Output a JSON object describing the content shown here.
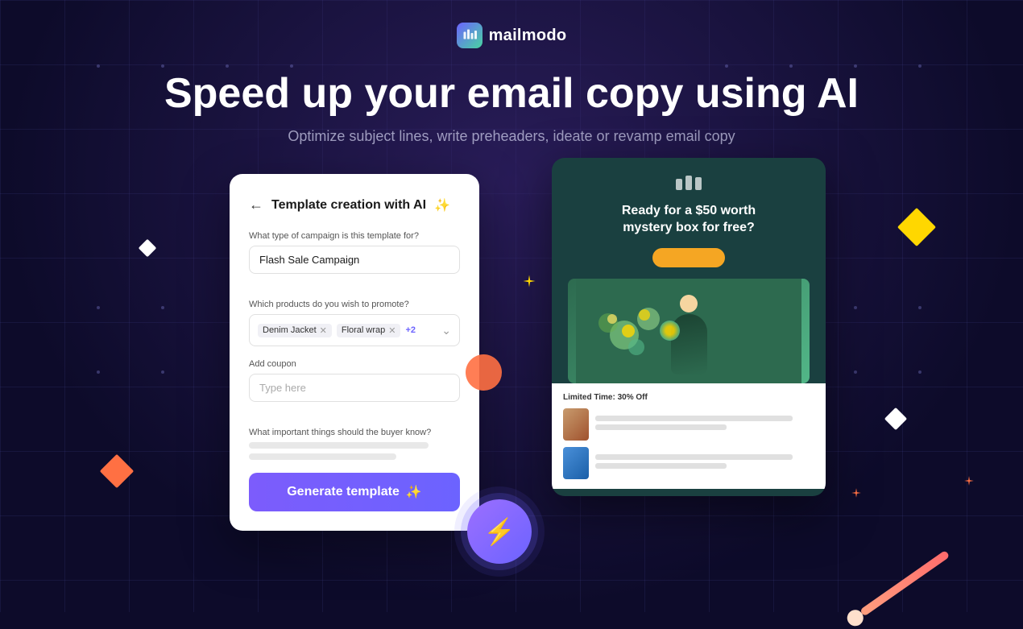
{
  "brand": {
    "name": "mailmodo",
    "logo_alt": "mailmodo logo"
  },
  "hero": {
    "title": "Speed up your email copy using AI",
    "subtitle": "Optimize subject lines, write preheaders, ideate or revamp email copy"
  },
  "form_panel": {
    "back_label": "←",
    "title": "Template creation with AI",
    "sparkle": "✨",
    "campaign_type_label": "What type of campaign is this template for?",
    "campaign_type_value": "Flash Sale Campaign",
    "products_label": "Which products do you wish to promote?",
    "products": [
      {
        "name": "Denim Jacket"
      },
      {
        "name": "Floral wrap"
      }
    ],
    "products_more": "+2",
    "coupon_label": "Add coupon",
    "coupon_placeholder": "Type here",
    "buyer_label": "What important things should the buyer know?",
    "generate_btn_label": "Generate template",
    "generate_btn_icon": "✨"
  },
  "email_preview": {
    "headline": "Ready for a $50 worth\nmystery box for free?",
    "limited_time": "Limited Time: 30% Off",
    "logo_icon": "⏭"
  },
  "decorations": {
    "diamonds": [
      {
        "color": "#ffffff",
        "size": 18,
        "position": "top-left"
      },
      {
        "color": "#ffffff",
        "size": 22,
        "position": "right-mid"
      },
      {
        "color": "#ff7043",
        "size": 28,
        "position": "left-bottom"
      },
      {
        "color": "#ffd700",
        "size": 32,
        "position": "top-right"
      }
    ]
  }
}
